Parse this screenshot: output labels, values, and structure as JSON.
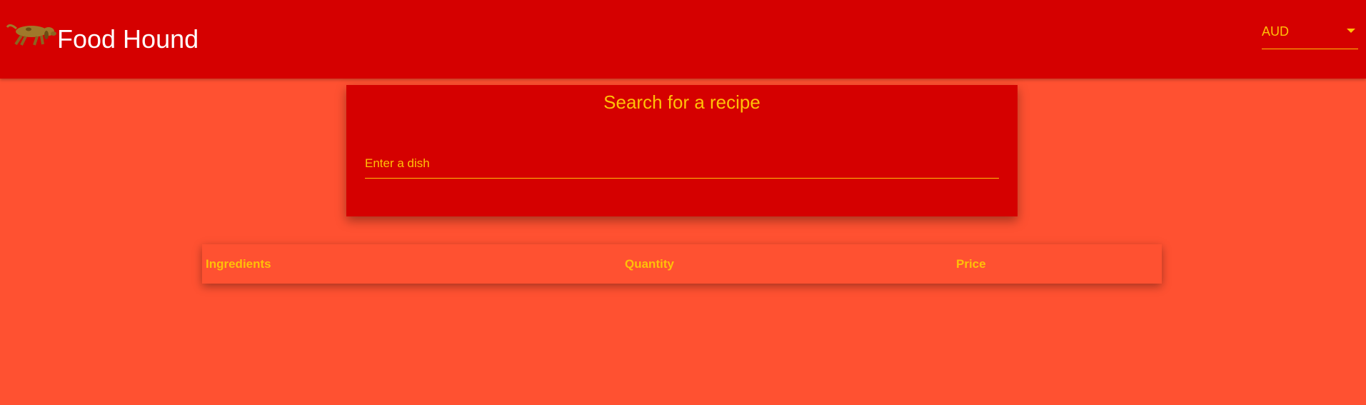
{
  "header": {
    "title": "Food Hound",
    "logo_icon": "dog-icon",
    "currency": {
      "selected": "AUD",
      "caret_icon": "dropdown-caret-icon"
    }
  },
  "search": {
    "title": "Search for a recipe",
    "placeholder": "Enter a dish",
    "value": ""
  },
  "table": {
    "columns": [
      "Ingredients",
      "Quantity",
      "Price"
    ],
    "rows": []
  },
  "colors": {
    "appbar": "#d50000",
    "background": "#ff5131",
    "accent": "#ffc107",
    "title_text": "#ffffff"
  }
}
